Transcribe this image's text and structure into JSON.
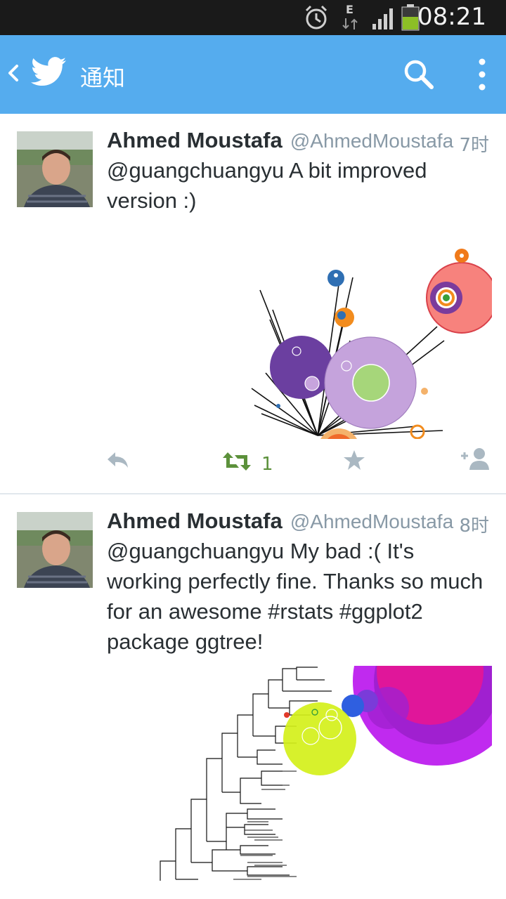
{
  "status_bar": {
    "time": "08:21",
    "network_letter": "E"
  },
  "app_bar": {
    "title": "通知"
  },
  "tweets": [
    {
      "name": "Ahmed Moustafa",
      "handle": "@AhmedMoustafa",
      "time": "7时",
      "text": "@guangchuangyu A bit improved version :)",
      "retweet_count": "1"
    },
    {
      "name": "Ahmed Moustafa",
      "handle": "@AhmedMoustafa",
      "time": "8时",
      "text": "@guangchuangyu My bad :( It's working perfectly fine. Thanks so much for an awesome #rstats #ggplot2 package ggtree!"
    }
  ],
  "colors": {
    "accent": "#55acee",
    "retweet_active": "#5c913b",
    "muted": "#8899a6"
  },
  "icons": [
    "alarm-icon",
    "data-arrows-icon",
    "signal-icon",
    "battery-icon",
    "back-icon",
    "twitter-bird-icon",
    "search-icon",
    "more-icon",
    "reply-icon",
    "retweet-icon",
    "favorite-icon",
    "follow-icon"
  ]
}
